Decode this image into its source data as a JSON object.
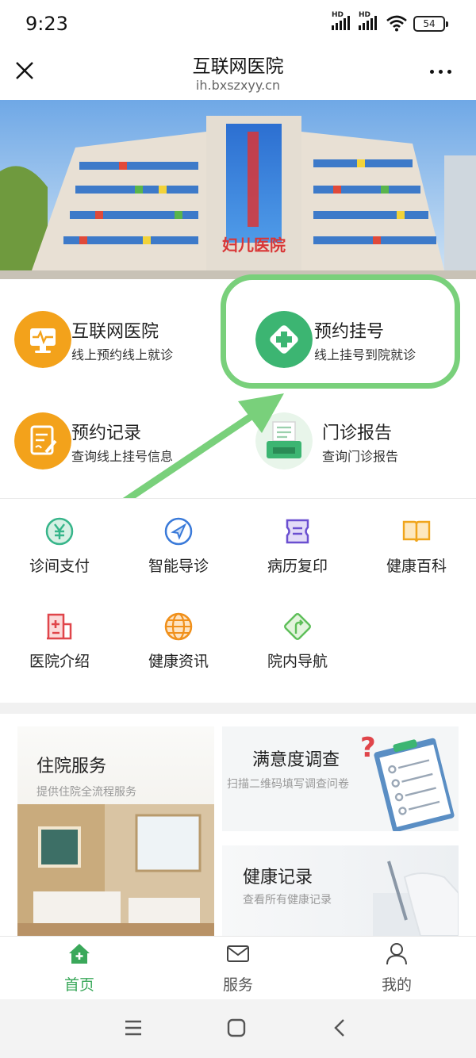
{
  "status": {
    "time": "9:23",
    "battery": "54",
    "signal1_label": "HD",
    "signal2_label": "HD"
  },
  "titlebar": {
    "title": "互联网医院",
    "subtitle": "ih.bxszxyy.cn"
  },
  "banner": {
    "sign_text": "妇儿医院"
  },
  "quick": [
    {
      "title": "互联网医院",
      "sub": "线上预约线上就诊",
      "icon": "monitor-pulse-icon",
      "color": "#f3a21b"
    },
    {
      "title": "预约挂号",
      "sub": "线上挂号到院就诊",
      "icon": "medical-cross-icon",
      "color": "#3cb572"
    },
    {
      "title": "预约记录",
      "sub": "查询线上挂号信息",
      "icon": "document-pen-icon",
      "color": "#f3a21b"
    },
    {
      "title": "门诊报告",
      "sub": "查询门诊报告",
      "icon": "printer-report-icon",
      "color": "#3cb572"
    }
  ],
  "services": [
    {
      "label": "诊间支付",
      "icon": "yuan-icon",
      "color": "#37b58a"
    },
    {
      "label": "智能导诊",
      "icon": "navigation-icon",
      "color": "#3a7ad9"
    },
    {
      "label": "病历复印",
      "icon": "ticket-icon",
      "color": "#6a4fd0"
    },
    {
      "label": "健康百科",
      "icon": "book-icon",
      "color": "#f0a51b"
    },
    {
      "label": "医院介绍",
      "icon": "hospital-plus-icon",
      "color": "#e0454a"
    },
    {
      "label": "健康资讯",
      "icon": "globe-icon",
      "color": "#f0901b"
    },
    {
      "label": "院内导航",
      "icon": "signpost-icon",
      "color": "#5fbf5a"
    }
  ],
  "cards": {
    "inpatient": {
      "title": "住院服务",
      "sub": "提供住院全流程服务"
    },
    "survey": {
      "title": "满意度调查",
      "sub": "扫描二维码填写调查问卷"
    },
    "records": {
      "title": "健康记录",
      "sub": "查看所有健康记录"
    }
  },
  "tabs": [
    {
      "label": "首页",
      "icon": "home-icon",
      "active": true
    },
    {
      "label": "服务",
      "icon": "mail-icon",
      "active": false
    },
    {
      "label": "我的",
      "icon": "user-icon",
      "active": false
    }
  ],
  "colors": {
    "accent": "#3aa85a",
    "highlight": "#79d07b"
  }
}
